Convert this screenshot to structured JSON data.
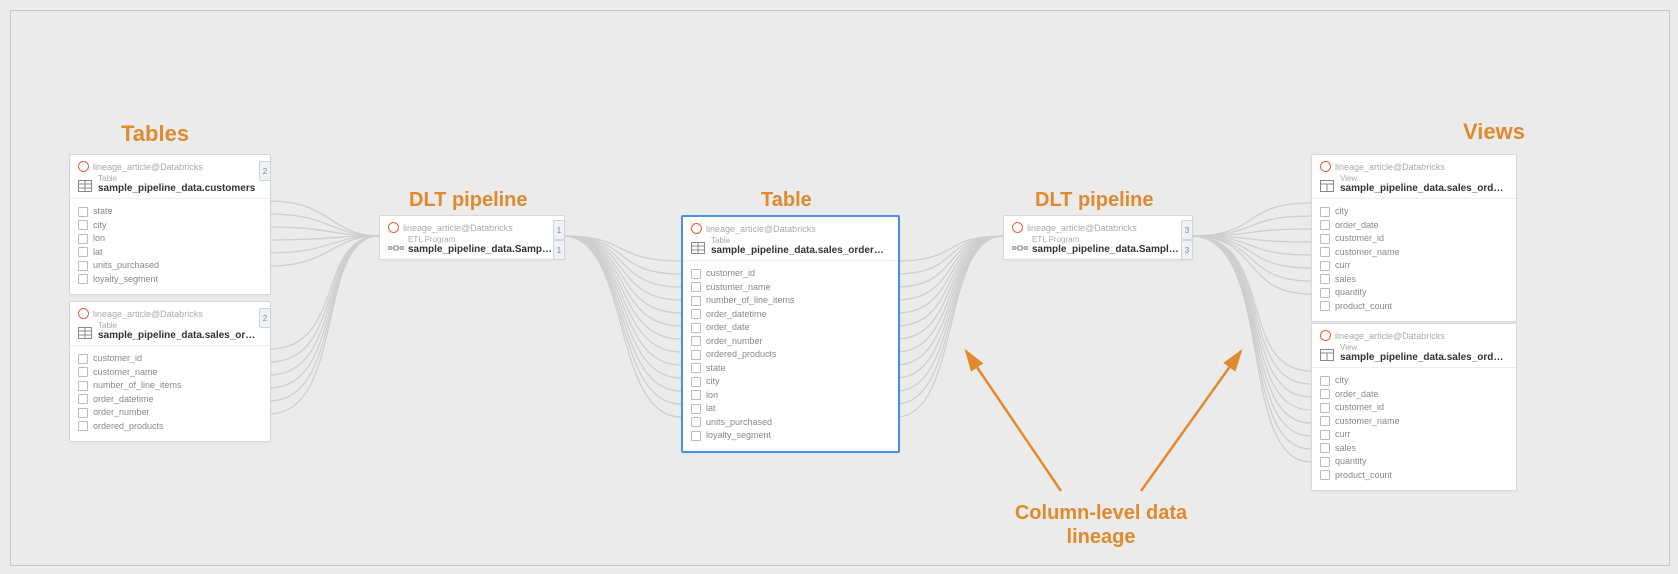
{
  "labels": {
    "tables": "Tables",
    "dlt1": "DLT pipeline",
    "table": "Table",
    "dlt2": "DLT pipeline",
    "views": "Views",
    "lineage": "Column-level data\nlineage"
  },
  "breadcrumb": "lineage_article@Databricks",
  "subtypes": {
    "table": "Table",
    "view": "View",
    "pipeline": "ETL Program"
  },
  "nodes": {
    "customers": {
      "title": "sample_pipeline_data.customers",
      "cols": [
        "state",
        "city",
        "lon",
        "lat",
        "units_purchased",
        "loyalty_segment"
      ]
    },
    "sales_orders": {
      "title": "sample_pipeline_data.sales_orders...",
      "cols": [
        "customer_id",
        "customer_name",
        "number_of_line_items",
        "order_datetime",
        "order_number",
        "ordered_products"
      ]
    },
    "pipeline1": {
      "title": "sample_pipeline_data.Sample_pipel..."
    },
    "center_table": {
      "title": "sample_pipeline_data.sales_orders...",
      "cols": [
        "customer_id",
        "customer_name",
        "number_of_line_items",
        "order_datetime",
        "order_date",
        "order_number",
        "ordered_products",
        "state",
        "city",
        "lon",
        "lat",
        "units_purchased",
        "loyalty_segment"
      ]
    },
    "pipeline2": {
      "title": "sample_pipeline_data.Sample_pipel..."
    },
    "view1": {
      "title": "sample_pipeline_data.sales_order_i...",
      "cols": [
        "city",
        "order_date",
        "customer_id",
        "customer_name",
        "curr",
        "sales",
        "quantity",
        "product_count"
      ]
    },
    "view2": {
      "title": "sample_pipeline_data.sales_order_i...",
      "cols": [
        "city",
        "order_date",
        "customer_id",
        "customer_name",
        "curr",
        "sales",
        "quantity",
        "product_count"
      ]
    }
  },
  "tab_numbers": {
    "two": "2",
    "one": "1",
    "three": "3"
  }
}
